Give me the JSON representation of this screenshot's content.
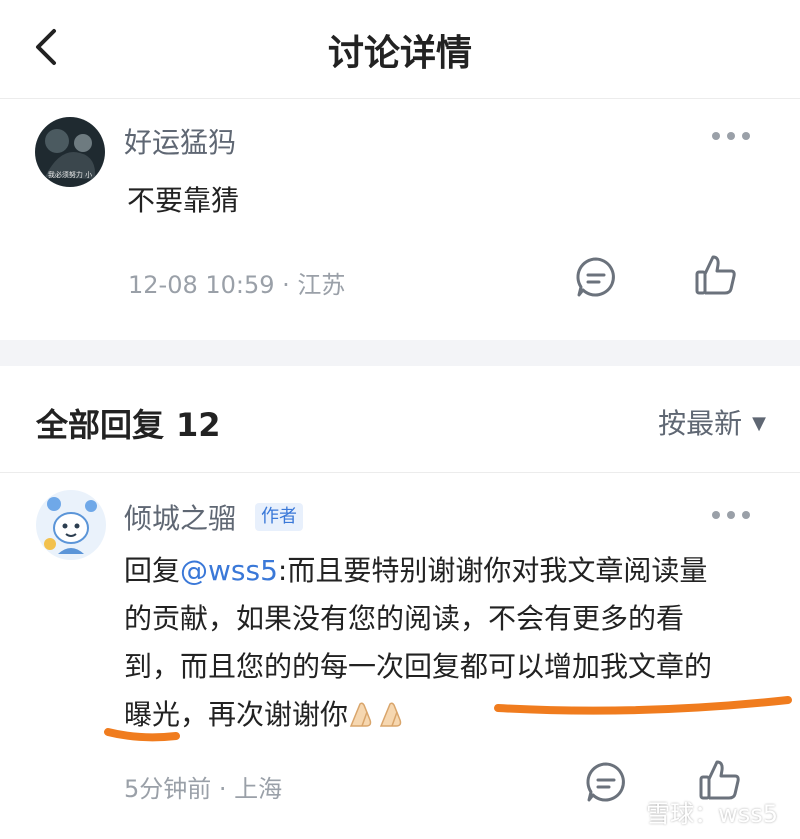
{
  "header": {
    "title": "讨论详情"
  },
  "post": {
    "username": "好运猛犸",
    "avatar_caption": "我必须努力 小",
    "content": "不要靠猜",
    "time_location": "12-08 10:59 · 江苏"
  },
  "replies": {
    "title": "全部回复",
    "count": "12",
    "sort_label": "按最新",
    "sort_caret": "▼"
  },
  "reply": {
    "username": "倾城之骝",
    "author_badge": "作者",
    "prefix": "回复",
    "mention": "@wss5",
    "line1": ":而且要特别谢谢你对我文章阅读量",
    "line2": "的贡献，如果没有您的阅读，不会有更多的看",
    "line3": "到，而且您的的每一次回复都可以增加我文章的",
    "line4": "曝光，再次谢谢你",
    "time_location": "5分钟前 · 上海"
  },
  "watermark": {
    "text": "雪球：wss5"
  },
  "colors": {
    "link": "#3a78d8",
    "muted": "#9aa0a8",
    "annotation": "#f07c1e",
    "divider": "#f3f4f7"
  },
  "icons": [
    "back-arrow-icon",
    "more-dots-icon",
    "comment-icon",
    "thumbs-up-icon",
    "clap-hands-emoji",
    "snowball-logo-icon"
  ]
}
